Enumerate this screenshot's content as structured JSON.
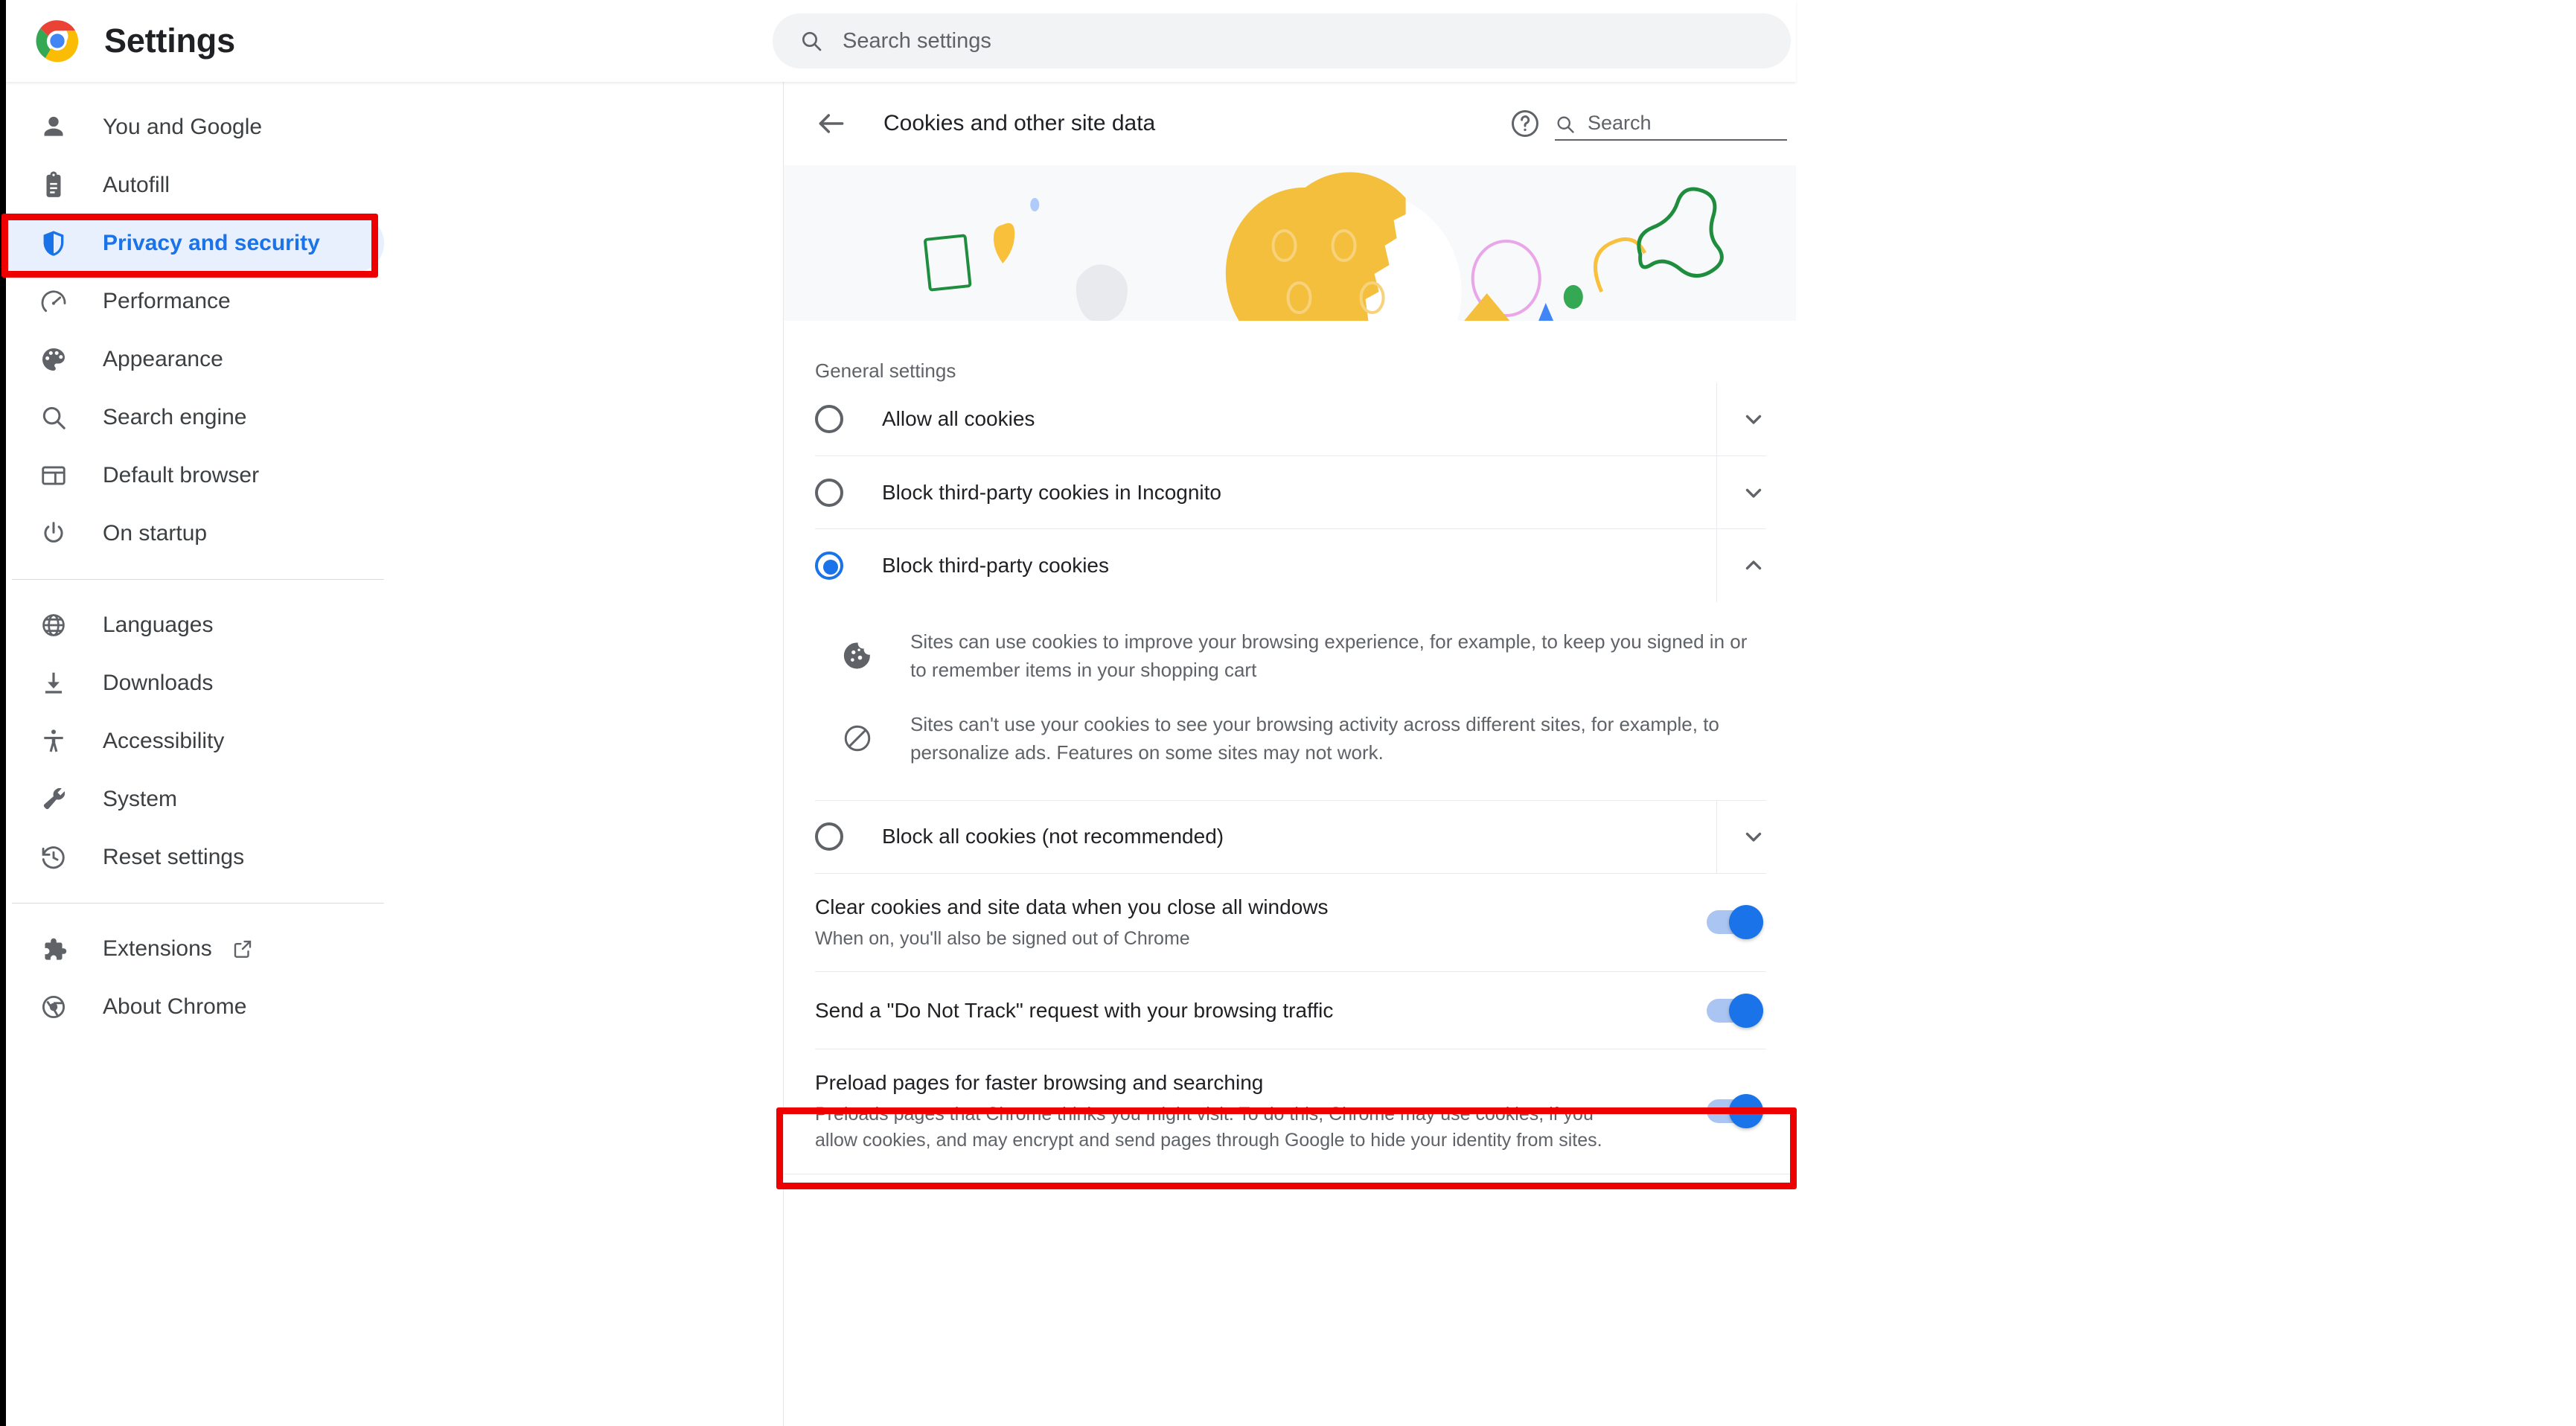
{
  "app": {
    "title": "Settings",
    "logo_icon": "chrome-logo-icon"
  },
  "search": {
    "placeholder": "Search settings",
    "value": "",
    "icon": "search-icon"
  },
  "sidebar": {
    "groups": [
      {
        "items": [
          {
            "label": "You and Google",
            "icon": "person-icon",
            "active": false
          },
          {
            "label": "Autofill",
            "icon": "clipboard-icon",
            "active": false
          },
          {
            "label": "Privacy and security",
            "icon": "shield-icon",
            "active": true
          },
          {
            "label": "Performance",
            "icon": "speedometer-icon",
            "active": false
          },
          {
            "label": "Appearance",
            "icon": "palette-icon",
            "active": false
          },
          {
            "label": "Search engine",
            "icon": "search-icon",
            "active": false
          },
          {
            "label": "Default browser",
            "icon": "browser-window-icon",
            "active": false
          },
          {
            "label": "On startup",
            "icon": "power-icon",
            "active": false
          }
        ]
      },
      {
        "items": [
          {
            "label": "Languages",
            "icon": "globe-icon",
            "active": false
          },
          {
            "label": "Downloads",
            "icon": "download-icon",
            "active": false
          },
          {
            "label": "Accessibility",
            "icon": "accessibility-icon",
            "active": false
          },
          {
            "label": "System",
            "icon": "wrench-icon",
            "active": false
          },
          {
            "label": "Reset settings",
            "icon": "history-restore-icon",
            "active": false
          }
        ]
      },
      {
        "items": [
          {
            "label": "Extensions",
            "icon": "puzzle-icon",
            "external": true,
            "active": false
          },
          {
            "label": "About Chrome",
            "icon": "chrome-outline-icon",
            "active": false
          }
        ]
      }
    ]
  },
  "subpage": {
    "back_icon": "back-arrow-icon",
    "title": "Cookies and other site data",
    "help_icon": "help-circle-icon",
    "search": {
      "placeholder": "Search",
      "value": "",
      "icon": "search-icon"
    },
    "banner_icon": "cookie-illustration"
  },
  "general_settings": {
    "heading": "General settings",
    "options": [
      {
        "label": "Allow all cookies",
        "selected": false,
        "expanded": false,
        "chevron_icon": "chevron-down-icon",
        "details": []
      },
      {
        "label": "Block third-party cookies in Incognito",
        "selected": false,
        "expanded": false,
        "chevron_icon": "chevron-down-icon",
        "details": []
      },
      {
        "label": "Block third-party cookies",
        "selected": true,
        "expanded": true,
        "chevron_icon": "chevron-up-icon",
        "details": [
          {
            "icon": "cookie-icon",
            "text": "Sites can use cookies to improve your browsing experience, for example, to keep you signed in or to remember items in your shopping cart"
          },
          {
            "icon": "block-circle-icon",
            "text": "Sites can't use your cookies to see your browsing activity across different sites, for example, to personalize ads. Features on some sites may not work."
          }
        ]
      },
      {
        "label": "Block all cookies (not recommended)",
        "selected": false,
        "expanded": false,
        "chevron_icon": "chevron-down-icon",
        "details": []
      }
    ]
  },
  "toggles": [
    {
      "title": "Clear cookies and site data when you close all windows",
      "subtitle": "When on, you'll also be signed out of Chrome",
      "on": true,
      "highlighted": true
    },
    {
      "title": "Send a \"Do Not Track\" request with your browsing traffic",
      "subtitle": "",
      "on": true,
      "highlighted": false
    },
    {
      "title": "Preload pages for faster browsing and searching",
      "subtitle": "Preloads pages that Chrome thinks you might visit. To do this, Chrome may use cookies, if you allow cookies, and may encrypt and send pages through Google to hide your identity from sites.",
      "on": true,
      "highlighted": false
    }
  ],
  "colors": {
    "accent": "#1a73e8",
    "active_nav_bg": "#e8f0fe",
    "highlight_box": "#ee0000",
    "text_primary": "#202124",
    "text_secondary": "#5f6368",
    "banner_bg": "#f8f9fa",
    "search_bg": "#f1f3f4"
  }
}
